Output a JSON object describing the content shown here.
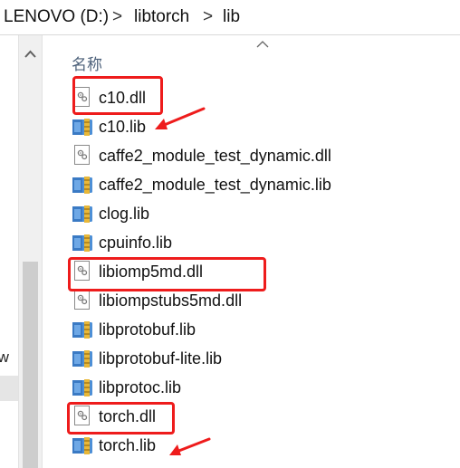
{
  "address_bar": {
    "segments": [
      "LENOVO (D:)",
      "libtorch",
      "lib"
    ],
    "separator": ">"
  },
  "nav_pane": {
    "cut_text": "-w"
  },
  "column_header": {
    "name_label": "名称"
  },
  "files": [
    {
      "name": "c10.dll",
      "type": "dll"
    },
    {
      "name": "c10.lib",
      "type": "lib"
    },
    {
      "name": "caffe2_module_test_dynamic.dll",
      "type": "dll"
    },
    {
      "name": "caffe2_module_test_dynamic.lib",
      "type": "lib"
    },
    {
      "name": "clog.lib",
      "type": "lib"
    },
    {
      "name": "cpuinfo.lib",
      "type": "lib"
    },
    {
      "name": "libiomp5md.dll",
      "type": "dll"
    },
    {
      "name": "libiompstubs5md.dll",
      "type": "dll"
    },
    {
      "name": "libprotobuf.lib",
      "type": "lib"
    },
    {
      "name": "libprotobuf-lite.lib",
      "type": "lib"
    },
    {
      "name": "libprotoc.lib",
      "type": "lib"
    },
    {
      "name": "torch.dll",
      "type": "dll"
    },
    {
      "name": "torch.lib",
      "type": "lib"
    }
  ],
  "annotations": {
    "highlighted_files": [
      "c10.dll",
      "libiomp5md.dll",
      "torch.dll"
    ],
    "arrowed_files": [
      "c10.lib",
      "torch.lib"
    ],
    "color": "#ee1c1c"
  },
  "icons": {
    "dll": "dll-file-icon",
    "lib": "lib-archive-icon"
  }
}
